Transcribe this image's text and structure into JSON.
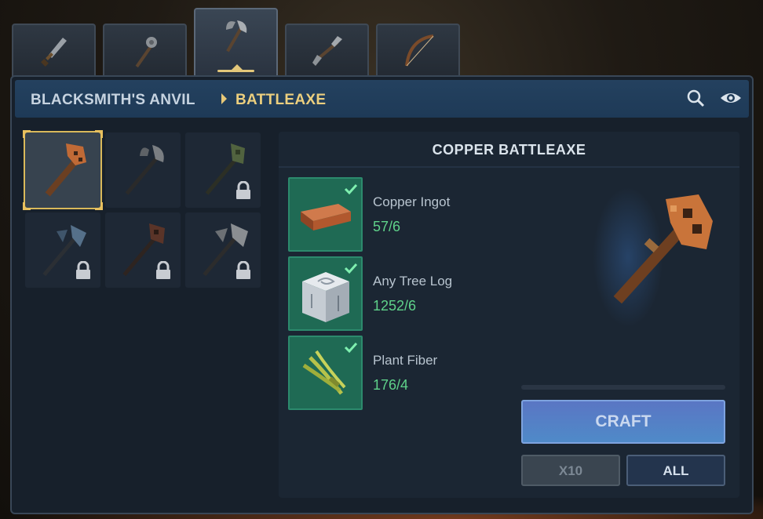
{
  "tabs": [
    {
      "name": "daggers",
      "active": false
    },
    {
      "name": "maces",
      "active": false
    },
    {
      "name": "battleaxes",
      "active": true
    },
    {
      "name": "spears",
      "active": false
    },
    {
      "name": "bows",
      "active": false
    }
  ],
  "header": {
    "breadcrumb_root": "BLACKSMITH'S ANVIL",
    "breadcrumb_current": "BATTLEAXE",
    "icons": [
      "search-icon",
      "eye-icon"
    ]
  },
  "items": [
    {
      "id": "copper",
      "selected": true,
      "locked": false
    },
    {
      "id": "iron",
      "selected": false,
      "locked": false
    },
    {
      "id": "moss",
      "selected": false,
      "locked": true
    },
    {
      "id": "steel-blue",
      "selected": false,
      "locked": true
    },
    {
      "id": "dark",
      "selected": false,
      "locked": true
    },
    {
      "id": "silver",
      "selected": false,
      "locked": true
    }
  ],
  "detail": {
    "title": "COPPER BATTLEAXE",
    "ingredients": [
      {
        "name": "Copper Ingot",
        "count": "57/6",
        "icon": "copper-ingot-icon",
        "satisfied": true
      },
      {
        "name": "Any Tree Log",
        "count": "1252/6",
        "icon": "tree-log-icon",
        "satisfied": true
      },
      {
        "name": "Plant Fiber",
        "count": "176/4",
        "icon": "plant-fiber-icon",
        "satisfied": true
      }
    ],
    "craft_label": "CRAFT",
    "x10_label": "X10",
    "all_label": "ALL"
  },
  "colors": {
    "accent_gold": "#e3c77a",
    "ok_green": "#5fd28a",
    "craft_blue": "#5a7fc6"
  }
}
